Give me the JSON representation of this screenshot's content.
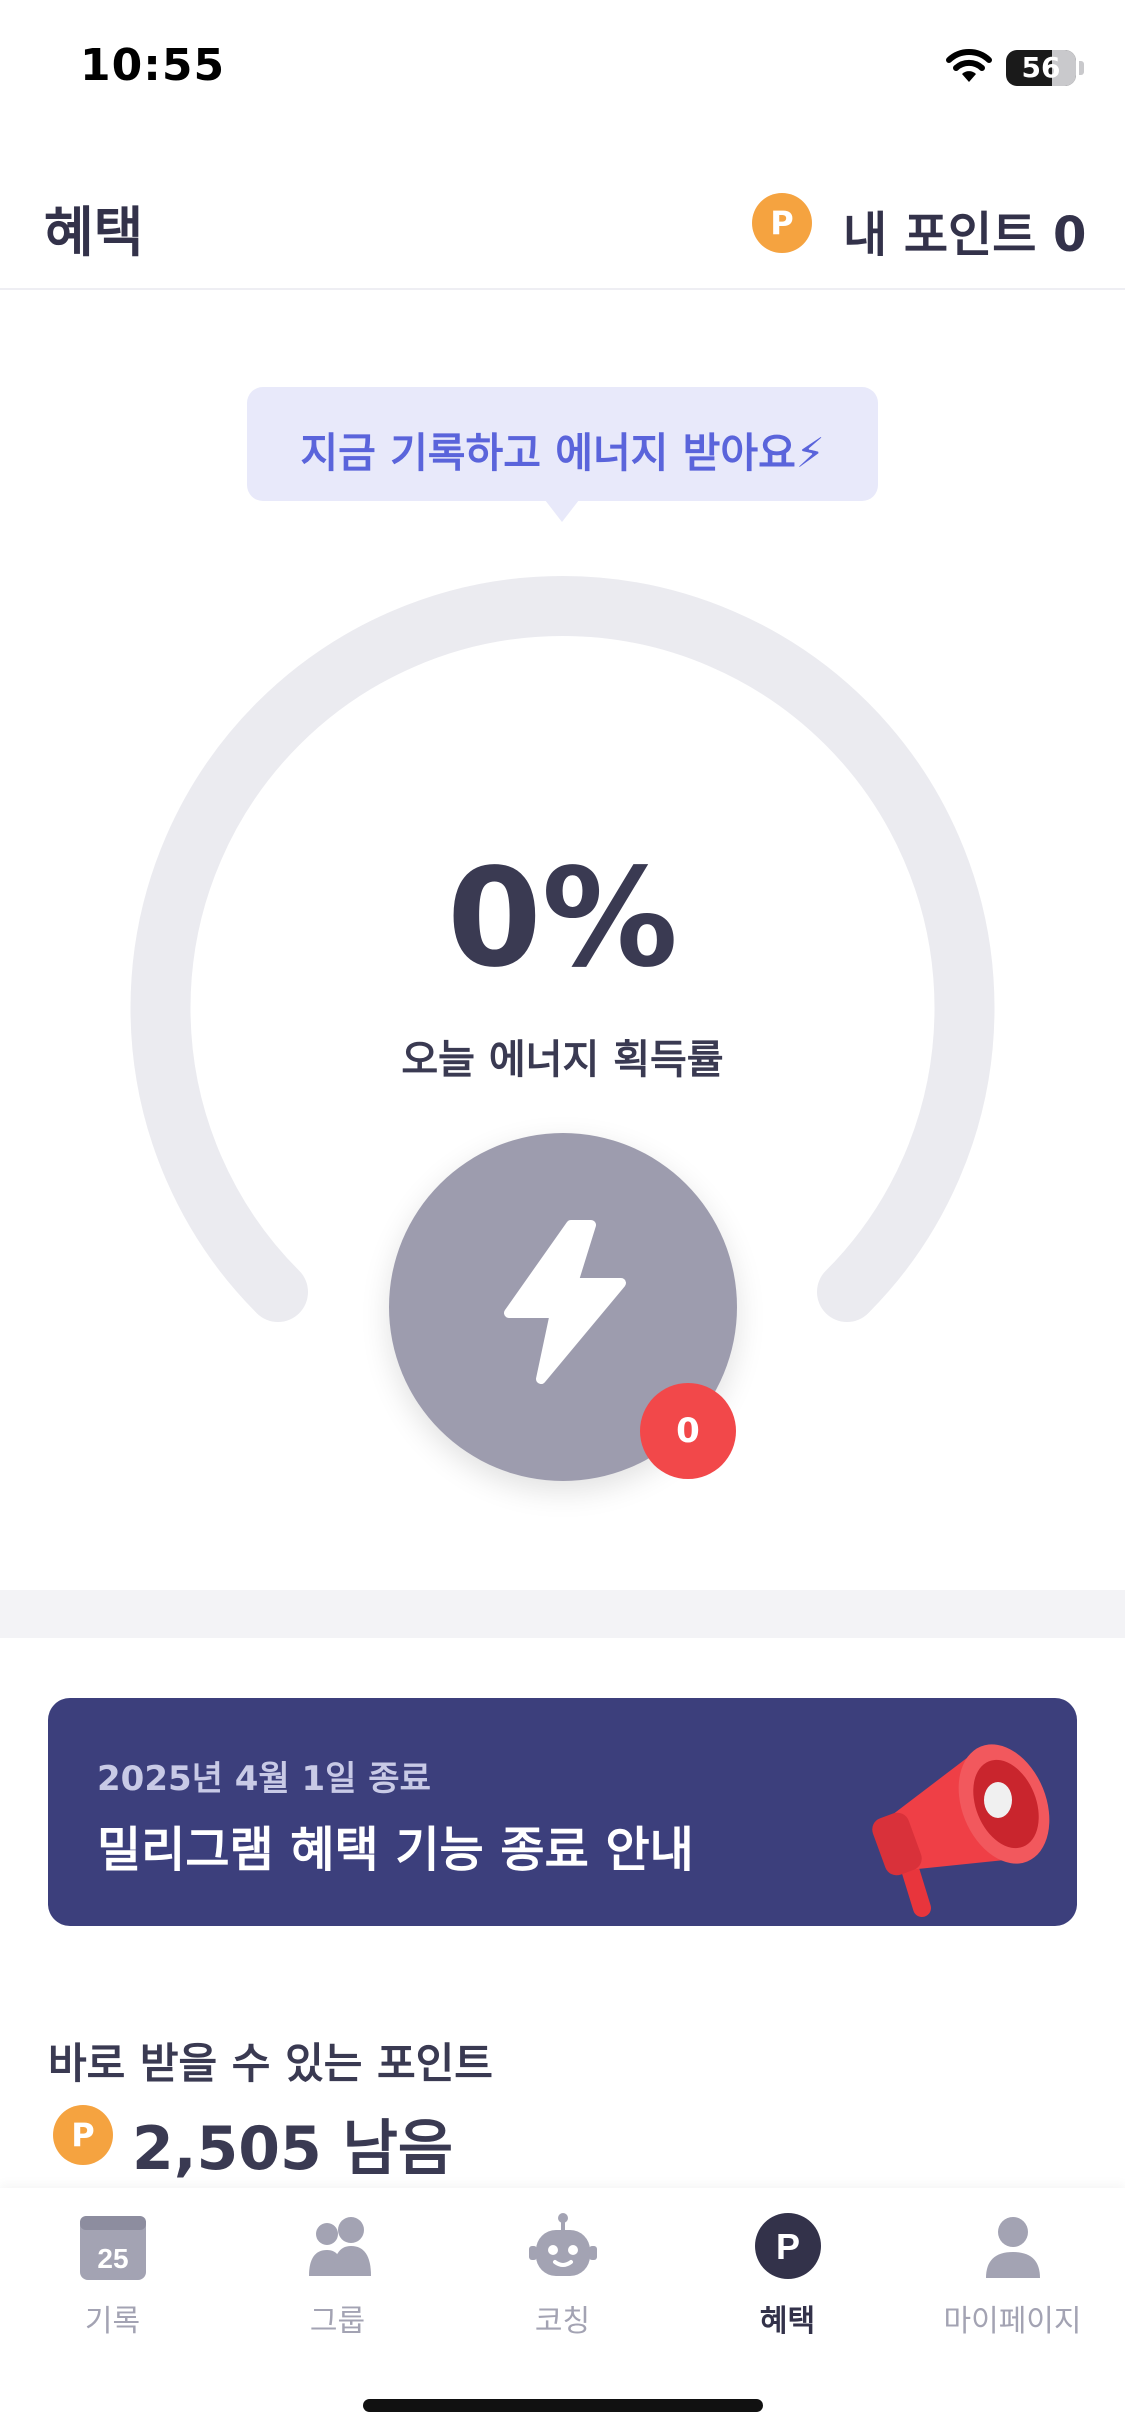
{
  "status_bar": {
    "time": "10:55",
    "battery": "56",
    "battery_level": 0.56
  },
  "header": {
    "title": "혜택",
    "point_symbol": "P",
    "my_points": "내 포인트 0"
  },
  "tooltip": {
    "text": "지금 기록하고 에너지 받아요⚡"
  },
  "energy": {
    "percent": "0%",
    "label": "오늘 에너지 획득률",
    "count": "0",
    "progress": 0
  },
  "banner": {
    "date": "2025년 4월 1일 종료",
    "title": "밀리그램 혜택 기능 종료 안내"
  },
  "points": {
    "label": "바로 받을 수 있는 포인트",
    "symbol": "P",
    "remaining": "2,505 남음"
  },
  "tabs": [
    {
      "label": "기록",
      "icon": "calendar-icon",
      "badge": "25",
      "active": false
    },
    {
      "label": "그룹",
      "icon": "group-icon",
      "active": false
    },
    {
      "label": "코칭",
      "icon": "robot-icon",
      "active": false
    },
    {
      "label": "혜택",
      "icon": "point-icon",
      "badge": "P",
      "active": true
    },
    {
      "label": "마이페이지",
      "icon": "person-icon",
      "active": false
    }
  ],
  "colors": {
    "accent": "#5a64db",
    "point": "#f5a340",
    "badge": "#f2484a",
    "banner": "#3c3f7c",
    "gauge_track": "#ebebf0"
  }
}
